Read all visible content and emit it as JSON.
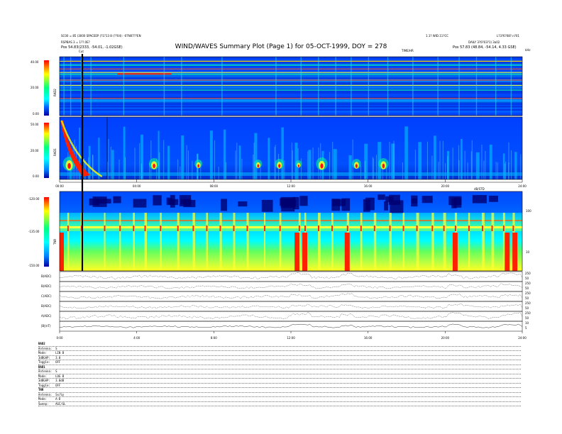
{
  "header": {
    "title": "WIND/WAVES Summary Plot (Page 1) for 05-OCT-1999, DOY = 278",
    "left_line1": "SC00 = 85 (3000 SPACEEP (?1?13 8 (??04): -07N07??EN",
    "left_line2": "RSPBAS 3 = 1??.0E?",
    "left_pos": "Pos   54.83(2333, -54.01, -1.02GSE)",
    "right_line1": "1.1? WID.11?CC",
    "right_line2": "L?3?6?08?.n?01",
    "right_line3": "DAILY 3?0?03?1) 3a02",
    "right_pos": "Pos   57.83 (48.84, -54.14, 4.33 GSE)",
    "hours_label_top": "TIME/HR",
    "khz_label": "kHz",
    "cursor_label": "Cut"
  },
  "panels": {
    "rad2": {
      "label": "RAD2",
      "ticks": [
        "40.00",
        "20.00",
        "0.00"
      ]
    },
    "rad1": {
      "label": "RAD1",
      "ticks": [
        "50.00",
        "20.00",
        "0.00"
      ]
    },
    "tnr": {
      "label": "TNR",
      "ticks": [
        "-120.00",
        "-135.00",
        "-150.00"
      ],
      "right_ticks": [
        "100",
        "10"
      ],
      "right_label": "dB/STD"
    },
    "time_axis": {
      "ticks": [
        "00:00",
        "04:00",
        "08:00",
        "12:00",
        "16:00",
        "20:00",
        "24:00"
      ]
    },
    "lines": [
      {
        "label": "B(ADC)",
        "right_ticks": [
          "250",
          "50"
        ]
      },
      {
        "label": "B(ADC)",
        "right_ticks": [
          "250",
          "50"
        ]
      },
      {
        "label": "C(ADC)",
        "right_ticks": [
          "250",
          "50"
        ]
      },
      {
        "label": "B(ADC)",
        "right_ticks": [
          "250",
          "50"
        ]
      },
      {
        "label": "A(ADC)",
        "right_ticks": [
          "250",
          "50"
        ]
      },
      {
        "label": "|B|(nT)",
        "right_ticks": [
          "10",
          "5"
        ]
      }
    ],
    "bottom_axis": {
      "ticks": [
        "0:00",
        "4:00",
        "8:00",
        "12:00",
        "16:00",
        "20:00",
        "24:00"
      ]
    }
  },
  "chart_data": {
    "type": "heatmap",
    "title": "WIND/WAVES Summary Plot (Page 1) for 05-OCT-1999, DOY = 278",
    "x": {
      "label": "",
      "range": [
        0,
        24
      ],
      "ticks": [
        "00:00",
        "04:00",
        "08:00",
        "12:00",
        "16:00",
        "20:00",
        "24:00"
      ]
    },
    "rad2_burst_hours": [
      0.2,
      0.55,
      1.1,
      1.6,
      3.3,
      5.4,
      6.3,
      8.4,
      11.2,
      12.5,
      13.4,
      14.3,
      15.1,
      16.0,
      17.0,
      18.3,
      19.6,
      20.7,
      21.6,
      22.6,
      23.4
    ],
    "rad2_freq_bands": [
      0.93,
      0.86,
      0.8,
      0.74,
      0.71,
      0.61,
      0.52,
      0.44,
      0.3
    ],
    "rad1_burst_hours": [
      0.5,
      1.0,
      1.5,
      2.0,
      2.7,
      3.3,
      4.2,
      5.1,
      5.6,
      6.3,
      7.1,
      7.8,
      8.5,
      9.3,
      10.1,
      10.8,
      11.5,
      12.2,
      12.9,
      13.6,
      14.2,
      15.0,
      15.8,
      16.5,
      17.2,
      17.9,
      18.6,
      19.4,
      20.1,
      20.8,
      21.6,
      22.3,
      23.0,
      23.6
    ],
    "rad1_events": [
      {
        "hour": 0.5,
        "strength": 1.0
      },
      {
        "hour": 4.9,
        "strength": 0.8
      },
      {
        "hour": 7.2,
        "strength": 0.6
      },
      {
        "hour": 10.3,
        "strength": 0.6
      },
      {
        "hour": 11.4,
        "strength": 0.7
      },
      {
        "hour": 12.4,
        "strength": 0.5
      },
      {
        "hour": 13.6,
        "strength": 0.9
      },
      {
        "hour": 15.4,
        "strength": 0.7
      },
      {
        "hour": 16.8,
        "strength": 0.8
      }
    ],
    "tnr_spikes": [
      0.4,
      1.1,
      2.3,
      3.1,
      3.8,
      4.4,
      5.2,
      6.1,
      6.9,
      7.6,
      8.3,
      9.0,
      9.7,
      10.6,
      11.4,
      12.4,
      12.7,
      13.4,
      14.1,
      14.9,
      15.6,
      16.3,
      17.1,
      17.8,
      18.5,
      19.3,
      19.9,
      20.5,
      21.2,
      21.9,
      22.4,
      23.0,
      23.5
    ],
    "tnr_strong_hours": [
      12.3,
      12.7,
      14.9,
      20.5,
      23.2,
      23.6
    ],
    "line_series_amplitude": [
      0.6,
      0.5,
      0.55,
      0.45,
      0.65,
      0.35
    ]
  },
  "info_block": {
    "sections": [
      {
        "head": "RAD2",
        "rows": [
          "Antenna:  S",
          "Mode:     LIN B",
          "3dBGAP:   3.0",
          "Toggle:   OFF"
        ]
      },
      {
        "head": "RAD1",
        "rows": [
          "Antenna:  S",
          "Mode:     LOG B",
          "3dBGAP:   3.0dB",
          "Toggle:   OFF"
        ]
      },
      {
        "head": "TNR",
        "rows": [
          "Antenna:  Sx/Sy",
          "Mode:     A-D",
          "Sweep:    AGC/GL"
        ]
      }
    ]
  },
  "colors": {
    "bg_blue": "#0040ff",
    "deep_blue": "#000090",
    "cyan": "#00ffff",
    "yellow": "#ffff00",
    "red": "#ff0000",
    "dark_red": "#900000"
  }
}
